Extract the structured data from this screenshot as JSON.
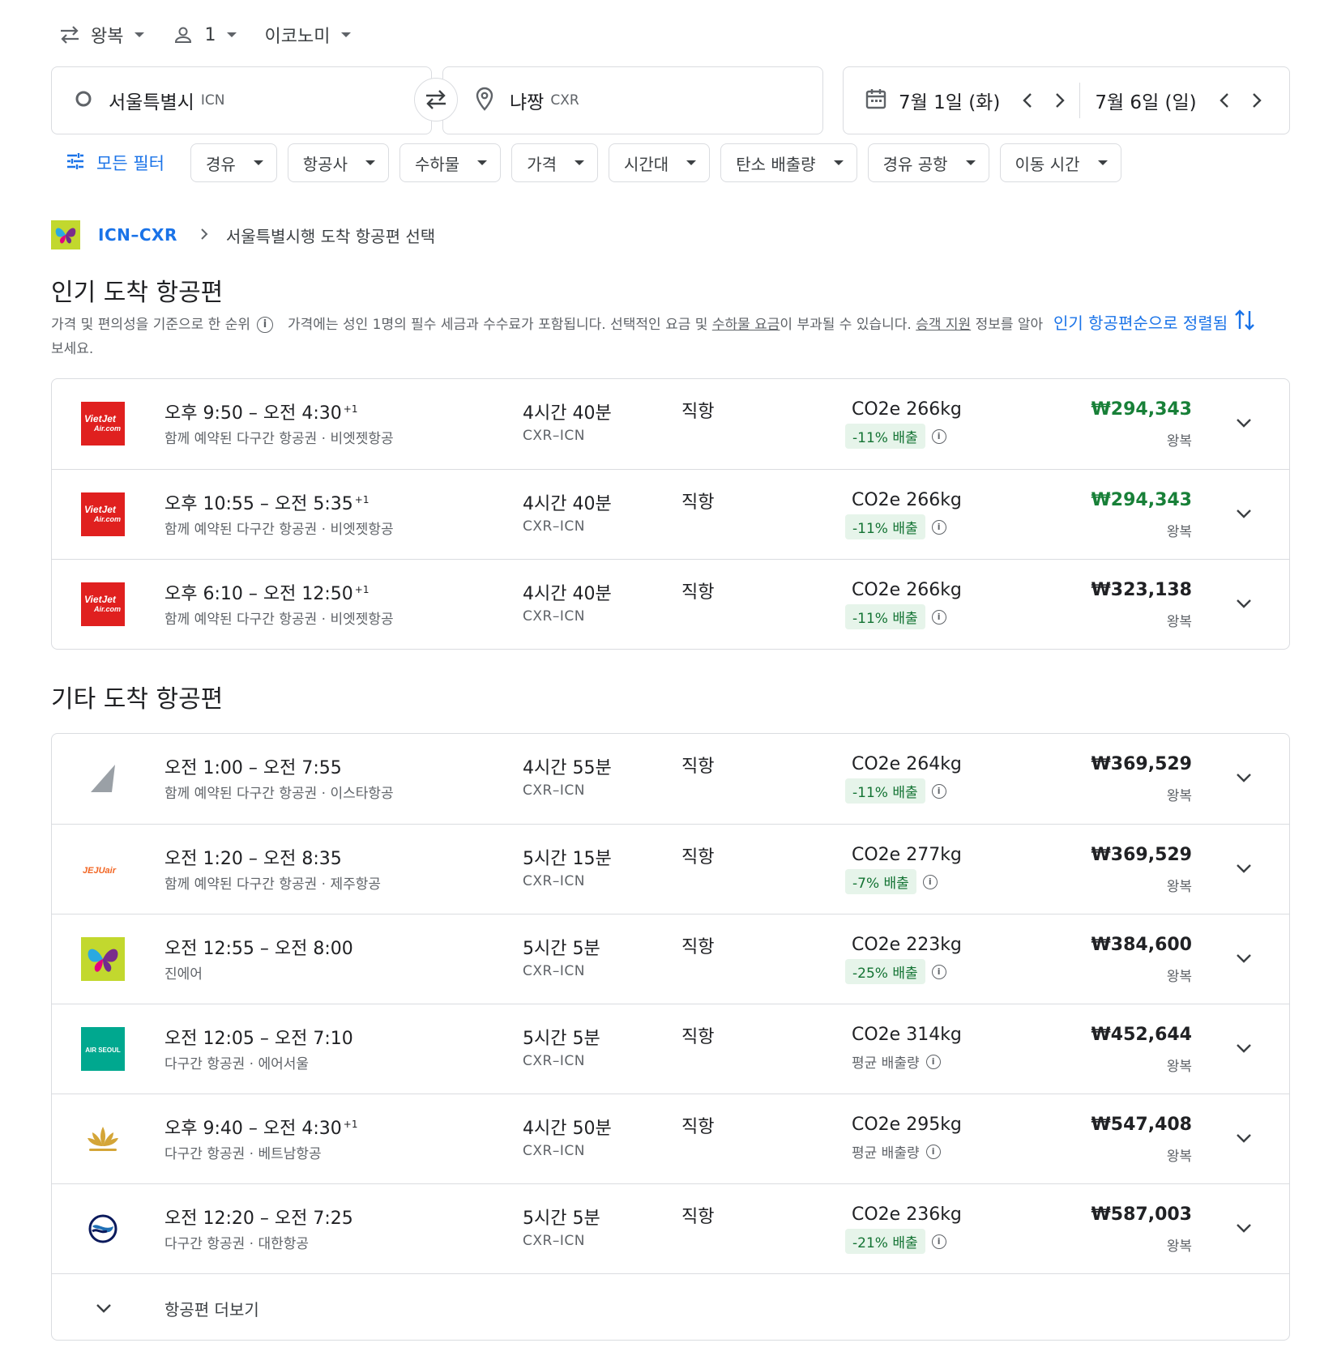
{
  "top": {
    "trip_type": "왕복",
    "passengers": "1",
    "cabin": "이코노미"
  },
  "search": {
    "origin_city": "서울특별시",
    "origin_code": "ICN",
    "dest_city": "냐짱",
    "dest_code": "CXR",
    "depart_date": "7월 1일 (화)",
    "return_date": "7월 6일 (일)"
  },
  "filters": {
    "all_label": "모든 필터",
    "chips": [
      "경유",
      "항공사",
      "수하물",
      "가격",
      "시간대",
      "탄소 배출량",
      "경유 공항",
      "이동 시간"
    ]
  },
  "breadcrumb": {
    "route": "ICN–CXR",
    "step": "서울특별시행 도착 항공편 선택"
  },
  "popular": {
    "title": "인기 도착 항공편",
    "desc_rank": "가격 및 편의성을 기준으로 한 순위",
    "desc_price_a": "가격에는 성인 1명의 필수 세금과 수수료가 포함됩니다. 선택적인 요금 및 ",
    "desc_baggage_link": "수하물 요금",
    "desc_price_b": "이 부과될 수 있습니다. ",
    "desc_support_link": "승객 지원",
    "desc_price_c": " 정보를 알아보세요.",
    "sort_label": "인기 항공편순으로 정렬됨"
  },
  "popular_flights": [
    {
      "logo": "vietjet",
      "depart": "오후 9:50",
      "arrive": "오전 4:30",
      "plus": "+1",
      "airline": "함께 예약된 다구간 항공권 · 비엣젯항공",
      "duration": "4시간 40분",
      "route": "CXR–ICN",
      "stops": "직항",
      "co2": "CO2e 266kg",
      "emission": "-11% 배출",
      "emission_type": "badge",
      "price": "₩294,343",
      "price_color": "#188038",
      "trip": "왕복"
    },
    {
      "logo": "vietjet",
      "depart": "오후 10:55",
      "arrive": "오전 5:35",
      "plus": "+1",
      "airline": "함께 예약된 다구간 항공권 · 비엣젯항공",
      "duration": "4시간 40분",
      "route": "CXR–ICN",
      "stops": "직항",
      "co2": "CO2e 266kg",
      "emission": "-11% 배출",
      "emission_type": "badge",
      "price": "₩294,343",
      "price_color": "#188038",
      "trip": "왕복"
    },
    {
      "logo": "vietjet",
      "depart": "오후 6:10",
      "arrive": "오전 12:50",
      "plus": "+1",
      "airline": "함께 예약된 다구간 항공권 · 비엣젯항공",
      "duration": "4시간 40분",
      "route": "CXR–ICN",
      "stops": "직항",
      "co2": "CO2e 266kg",
      "emission": "-11% 배출",
      "emission_type": "badge",
      "price": "₩323,138",
      "price_color": "#202124",
      "trip": "왕복"
    }
  ],
  "other": {
    "title": "기타 도착 항공편",
    "more_label": "항공편 더보기"
  },
  "other_flights": [
    {
      "logo": "eastar",
      "depart": "오전 1:00",
      "arrive": "오전 7:55",
      "plus": "",
      "airline": "함께 예약된 다구간 항공권 · 이스타항공",
      "duration": "4시간 55분",
      "route": "CXR–ICN",
      "stops": "직항",
      "co2": "CO2e 264kg",
      "emission": "-11% 배출",
      "emission_type": "badge",
      "price": "₩369,529",
      "price_color": "#202124",
      "trip": "왕복"
    },
    {
      "logo": "jejuair",
      "depart": "오전 1:20",
      "arrive": "오전 8:35",
      "plus": "",
      "airline": "함께 예약된 다구간 항공권 · 제주항공",
      "duration": "5시간 15분",
      "route": "CXR–ICN",
      "stops": "직항",
      "co2": "CO2e 277kg",
      "emission": "-7% 배출",
      "emission_type": "badge",
      "price": "₩369,529",
      "price_color": "#202124",
      "trip": "왕복"
    },
    {
      "logo": "jinair",
      "depart": "오전 12:55",
      "arrive": "오전 8:00",
      "plus": "",
      "airline": "진에어",
      "duration": "5시간 5분",
      "route": "CXR–ICN",
      "stops": "직항",
      "co2": "CO2e 223kg",
      "emission": "-25% 배출",
      "emission_type": "badge",
      "price": "₩384,600",
      "price_color": "#202124",
      "trip": "왕복"
    },
    {
      "logo": "airseoul",
      "depart": "오전 12:05",
      "arrive": "오전 7:10",
      "plus": "",
      "airline": "다구간 항공권 · 에어서울",
      "duration": "5시간 5분",
      "route": "CXR–ICN",
      "stops": "직항",
      "co2": "CO2e 314kg",
      "emission": "평균 배출량",
      "emission_type": "avg",
      "price": "₩452,644",
      "price_color": "#202124",
      "trip": "왕복"
    },
    {
      "logo": "vietnam",
      "depart": "오후 9:40",
      "arrive": "오전 4:30",
      "plus": "+1",
      "airline": "다구간 항공권 · 베트남항공",
      "duration": "4시간 50분",
      "route": "CXR–ICN",
      "stops": "직항",
      "co2": "CO2e 295kg",
      "emission": "평균 배출량",
      "emission_type": "avg",
      "price": "₩547,408",
      "price_color": "#202124",
      "trip": "왕복"
    },
    {
      "logo": "koreanair",
      "depart": "오전 12:20",
      "arrive": "오전 7:25",
      "plus": "",
      "airline": "다구간 항공권 · 대한항공",
      "duration": "5시간 5분",
      "route": "CXR–ICN",
      "stops": "직항",
      "co2": "CO2e 236kg",
      "emission": "-21% 배출",
      "emission_type": "badge",
      "price": "₩587,003",
      "price_color": "#202124",
      "trip": "왕복"
    }
  ],
  "logo_text": {
    "vietjet_a": "VietJet",
    "vietjet_b": "Air.com",
    "jejuair": "JEJUair",
    "airseoul": "AIR SEOUL"
  },
  "colors": {
    "accent": "#1a73e8",
    "price_green": "#188038",
    "badge_bg": "#e6f4ea",
    "badge_text": "#137333",
    "vietjet_red": "#e0201f",
    "airseoul_teal": "#00a88f",
    "jinair_lime": "#c2d82e"
  }
}
